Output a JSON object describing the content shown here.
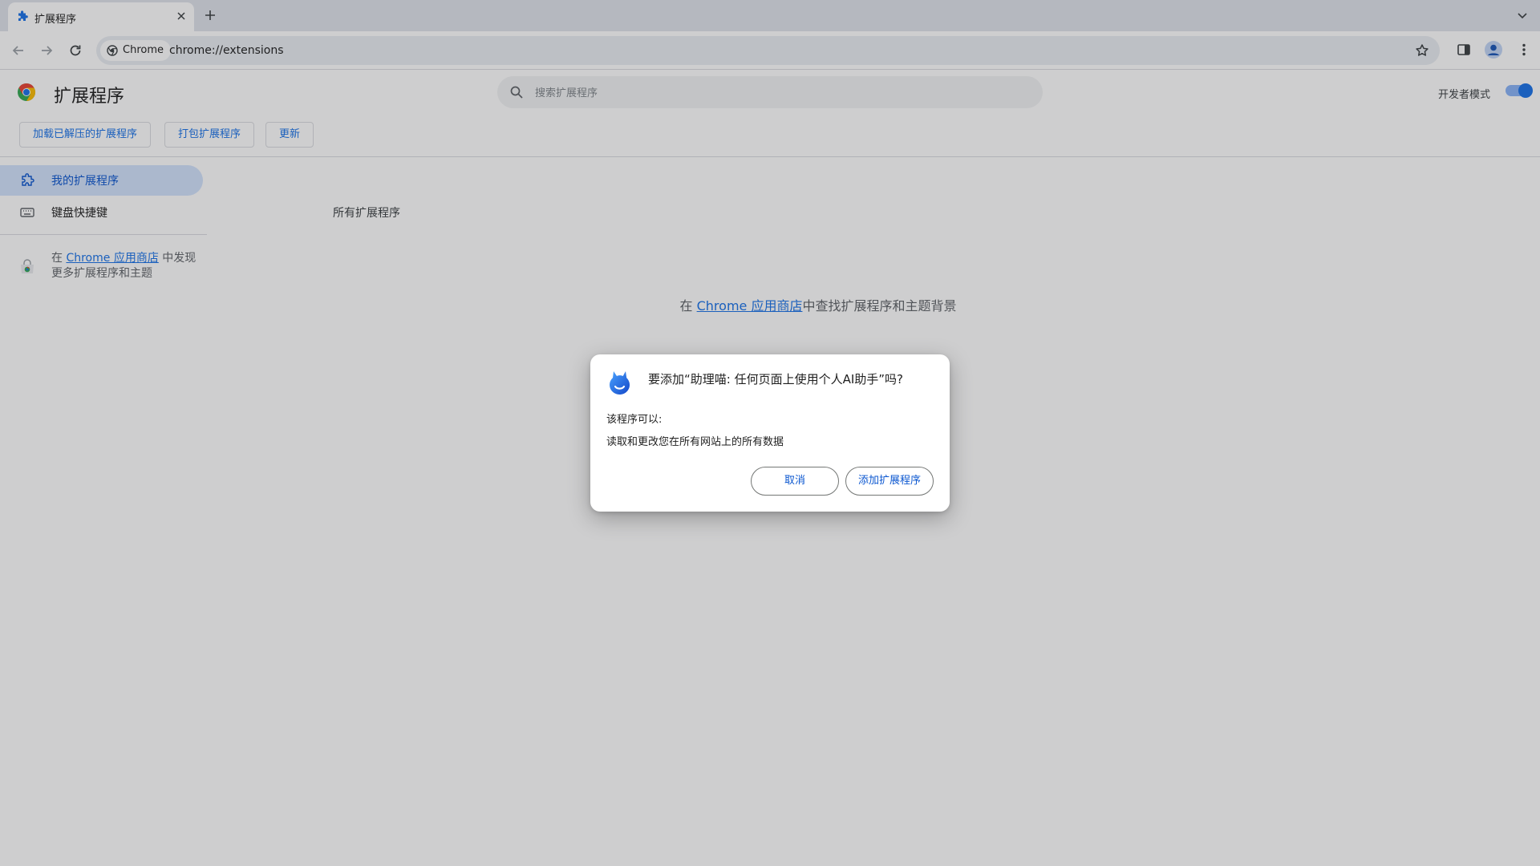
{
  "browser": {
    "tab_title": "扩展程序",
    "chip_label": "Chrome",
    "url": "chrome://extensions"
  },
  "header": {
    "title": "扩展程序",
    "search_placeholder": "搜索扩展程序",
    "dev_mode_label": "开发者模式",
    "dev_mode_on": true
  },
  "actions": {
    "load_unpacked": "加载已解压的扩展程序",
    "pack": "打包扩展程序",
    "update": "更新"
  },
  "sidebar": {
    "items": [
      {
        "label": "我的扩展程序",
        "active": true
      },
      {
        "label": "键盘快捷键",
        "active": false
      }
    ],
    "discover_prefix": "在",
    "discover_link": "Chrome 应用商店",
    "discover_suffix": "中发现",
    "discover_line2": "更多扩展程序和主题"
  },
  "main": {
    "section_title": "所有扩展程序",
    "empty_prefix": "在",
    "empty_link": "Chrome 应用商店",
    "empty_suffix": "中查找扩展程序和主题背景"
  },
  "dialog": {
    "title": "要添加“助理喵: 任何页面上使用个人AI助手”吗?",
    "subtitle": "该程序可以:",
    "permission": "读取和更改您在所有网站上的所有数据",
    "cancel": "取消",
    "add": "添加扩展程序"
  },
  "colors": {
    "accent": "#1a73e8",
    "dialog_button_text": "#0b57d0",
    "tabstrip": "#dfe3eb",
    "active_nav": "#d3e3fd"
  }
}
